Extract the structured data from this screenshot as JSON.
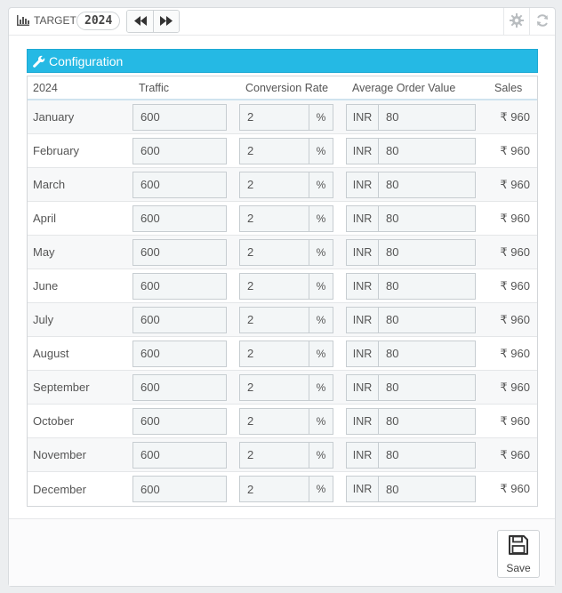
{
  "header": {
    "title": "TARGET",
    "year": "2024",
    "nav_prev_icon": "fast-backward-icon",
    "nav_next_icon": "fast-forward-icon"
  },
  "config": {
    "title": "Configuration",
    "accent_color": "#25b9e4"
  },
  "table": {
    "headers": {
      "year": "2024",
      "traffic": "Traffic",
      "conversion": "Conversion Rate",
      "aov": "Average Order Value",
      "sales": "Sales"
    },
    "percent_addon": "%",
    "currency_addon": "INR",
    "rows": [
      {
        "month": "January",
        "traffic": "600",
        "conversion": "2",
        "aov": "80",
        "sales": "₹ 960"
      },
      {
        "month": "February",
        "traffic": "600",
        "conversion": "2",
        "aov": "80",
        "sales": "₹ 960"
      },
      {
        "month": "March",
        "traffic": "600",
        "conversion": "2",
        "aov": "80",
        "sales": "₹ 960"
      },
      {
        "month": "April",
        "traffic": "600",
        "conversion": "2",
        "aov": "80",
        "sales": "₹ 960"
      },
      {
        "month": "May",
        "traffic": "600",
        "conversion": "2",
        "aov": "80",
        "sales": "₹ 960"
      },
      {
        "month": "June",
        "traffic": "600",
        "conversion": "2",
        "aov": "80",
        "sales": "₹ 960"
      },
      {
        "month": "July",
        "traffic": "600",
        "conversion": "2",
        "aov": "80",
        "sales": "₹ 960"
      },
      {
        "month": "August",
        "traffic": "600",
        "conversion": "2",
        "aov": "80",
        "sales": "₹ 960"
      },
      {
        "month": "September",
        "traffic": "600",
        "conversion": "2",
        "aov": "80",
        "sales": "₹ 960"
      },
      {
        "month": "October",
        "traffic": "600",
        "conversion": "2",
        "aov": "80",
        "sales": "₹ 960"
      },
      {
        "month": "November",
        "traffic": "600",
        "conversion": "2",
        "aov": "80",
        "sales": "₹ 960"
      },
      {
        "month": "December",
        "traffic": "600",
        "conversion": "2",
        "aov": "80",
        "sales": "₹ 960"
      }
    ]
  },
  "footer": {
    "save_label": "Save"
  }
}
